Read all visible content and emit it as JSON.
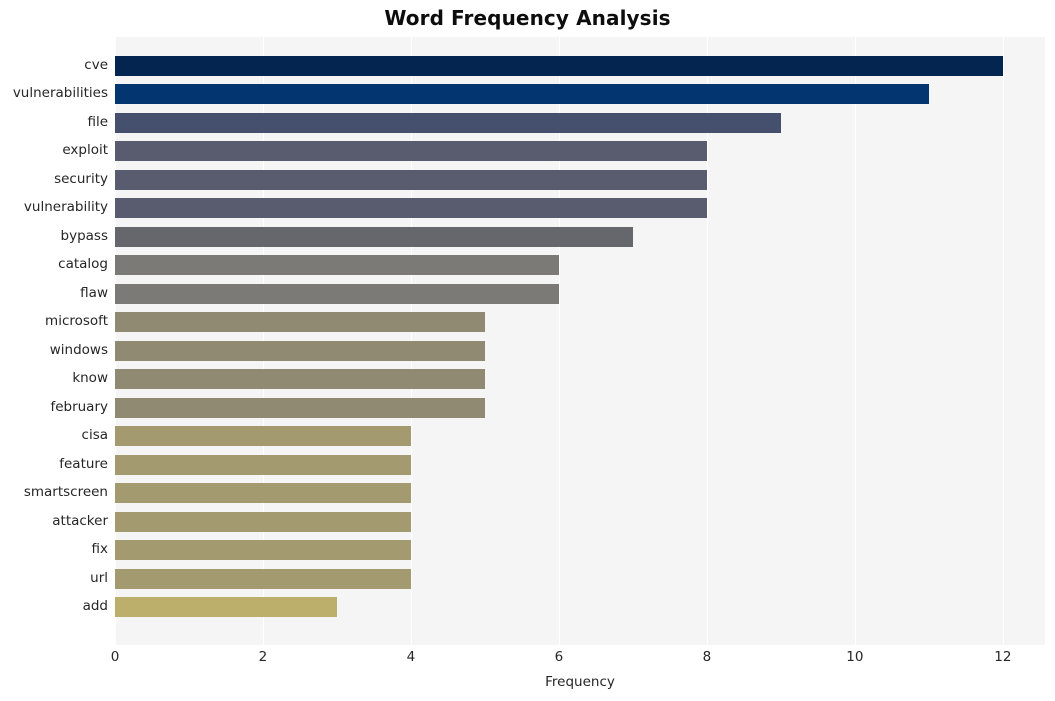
{
  "chart_data": {
    "type": "bar",
    "orientation": "horizontal",
    "title": "Word Frequency Analysis",
    "xlabel": "Frequency",
    "ylabel": "",
    "xlim": [
      0,
      12.57
    ],
    "xticks": [
      0,
      2,
      4,
      6,
      8,
      10,
      12
    ],
    "xticklabels": [
      "0",
      "2",
      "4",
      "6",
      "8",
      "10",
      "12"
    ],
    "grid": "vertical-only",
    "legend": "none",
    "categories": [
      "cve",
      "vulnerabilities",
      "file",
      "exploit",
      "security",
      "vulnerability",
      "bypass",
      "catalog",
      "flaw",
      "microsoft",
      "windows",
      "know",
      "february",
      "cisa",
      "feature",
      "smartscreen",
      "attacker",
      "fix",
      "url",
      "add"
    ],
    "values": [
      12,
      11,
      9,
      8,
      8,
      8,
      7,
      6,
      6,
      5,
      5,
      5,
      5,
      4,
      4,
      4,
      4,
      4,
      4,
      3
    ],
    "bar_colors": [
      "#042550",
      "#033571",
      "#454f6e",
      "#585c6e",
      "#585c6e",
      "#585c6e",
      "#66666d",
      "#7b7a77",
      "#7b7a77",
      "#918a73",
      "#918a73",
      "#918a73",
      "#918a73",
      "#a39a6f",
      "#a39a6f",
      "#a39a6f",
      "#a39a6f",
      "#a39a6f",
      "#a39a6f",
      "#bcae6b"
    ]
  },
  "style": {
    "plot_background": "#f5f5f6",
    "figure_background": "#ffffff",
    "gridline_color": "#ffffff",
    "text_color": "#262626",
    "title_color": "#0d0d0d"
  }
}
